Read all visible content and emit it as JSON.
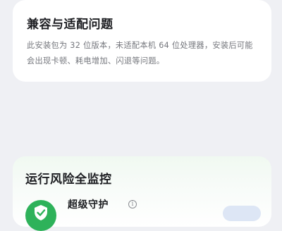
{
  "compat": {
    "title": "兼容与适配问题",
    "body": "此安装包为 32 位版本，未适配本机 64 位处理器，安装后可能会出现卡顿、耗电增加、闪退等问题。"
  },
  "risk": {
    "title": "运行风险全监控",
    "protection_label": "超级守护",
    "info_icon": "i"
  },
  "colors": {
    "background": "#eff0f4",
    "shield_green": "#2eb25a",
    "title_text": "#1c1d21",
    "body_text": "#75777d"
  }
}
